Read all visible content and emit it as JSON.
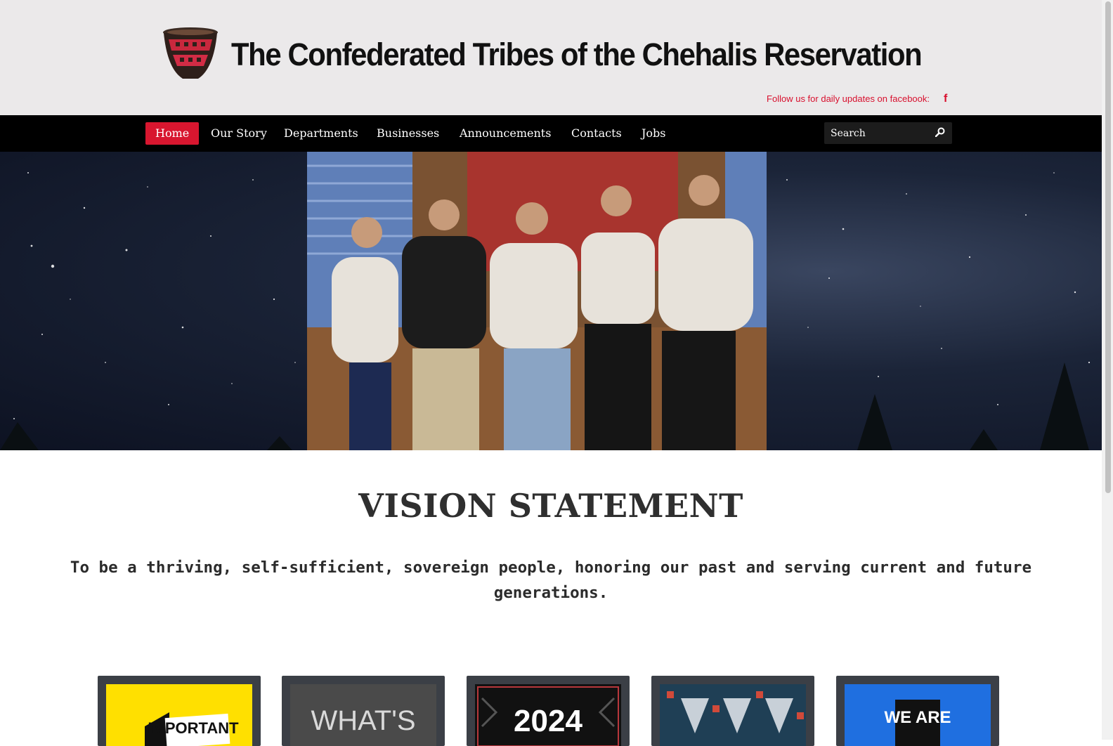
{
  "header": {
    "site_title": "The Confederated Tribes of the Chehalis Reservation",
    "follow_text": "Follow us for daily updates on facebook:",
    "facebook_glyph": "f",
    "logo_icon": "basket-logo-icon"
  },
  "nav": {
    "items": [
      {
        "label": "Home",
        "active": true
      },
      {
        "label": "Our Story"
      },
      {
        "label": "Departments"
      },
      {
        "label": "Businesses"
      },
      {
        "label": "Announcements"
      },
      {
        "label": "Contacts"
      },
      {
        "label": "Jobs"
      }
    ],
    "search_placeholder": "Search"
  },
  "vision": {
    "title": "VISION STATEMENT",
    "text": "To be a thriving, self-sufficient, sovereign people, honoring our past and serving current and future generations."
  },
  "cards": [
    {
      "label": "IMPORTANT",
      "bg": "#ffe000",
      "fg": "#111111"
    },
    {
      "label": "WHAT'S",
      "bg": "#4a4a4a",
      "fg": "#d9d9d9"
    },
    {
      "label": "2024",
      "bg": "#111111",
      "fg": "#ffffff"
    },
    {
      "label": "",
      "bg": "#1f3f55",
      "fg": "#ffffff"
    },
    {
      "label": "WE ARE",
      "bg": "#1f6fe0",
      "fg": "#ffffff"
    }
  ],
  "colors": {
    "accent": "#d8162f",
    "header_bg": "#ebe9ea",
    "nav_bg": "#000000"
  }
}
